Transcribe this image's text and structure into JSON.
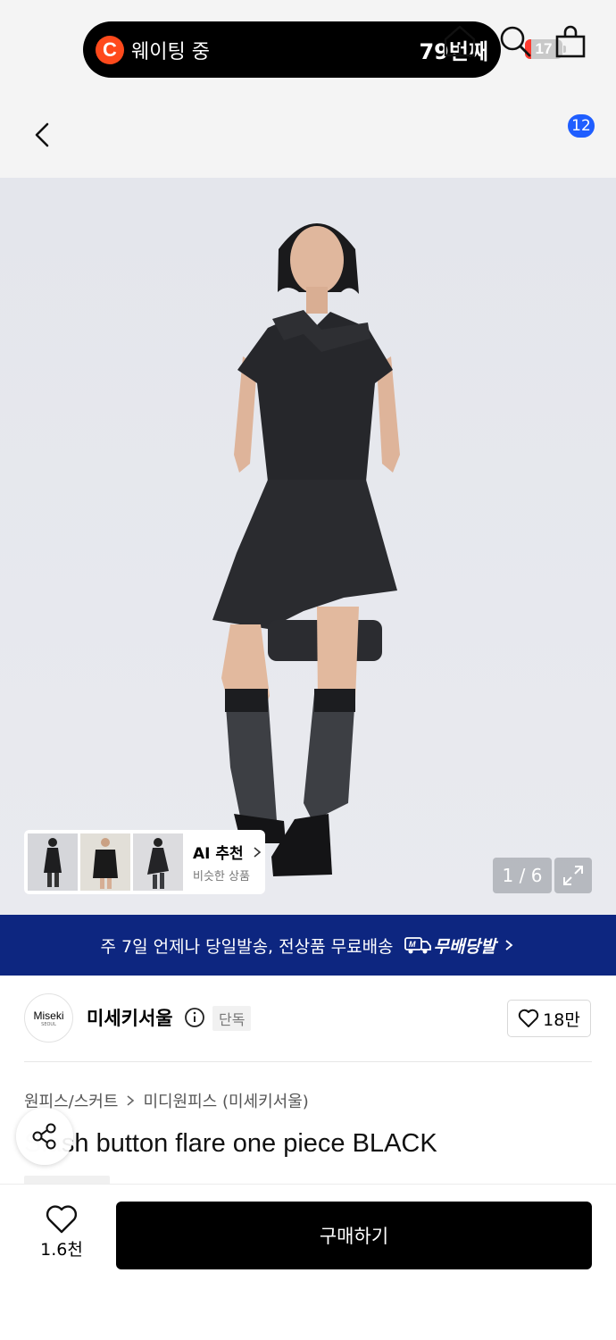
{
  "status_bar": {
    "waiting_logo": "C",
    "waiting_text": "웨이팅 중",
    "waiting_count": "79번째",
    "battery_level": "17",
    "battery_fraction": 0.17
  },
  "nav": {
    "back_icon": "chevron-left-icon",
    "home_icon": "home-icon",
    "search_icon": "search-icon",
    "cart_icon": "shopping-bag-icon",
    "cart_badge": "12"
  },
  "gallery": {
    "ai_title": "AI 추천",
    "ai_subtitle": "비슷한 상품",
    "counter": "1 / 6",
    "expand_icon": "expand-icon"
  },
  "promo": {
    "text": "주 7일 언제나 당일발송, 전상품 무료배송",
    "badge_label": "무배당발",
    "badge_mark": "M"
  },
  "brand": {
    "logo_text": "Miseki",
    "logo_sub": "SEOUL",
    "name": "미세키서울",
    "tag": "단독",
    "likes": "18만"
  },
  "product": {
    "breadcrumb": [
      "원피스/스커트",
      "미디원피스 (미세키서울)"
    ],
    "title": "Slash button flare one piece BLACK",
    "title_visible": "sh button flare one piece BLACK"
  },
  "bottom": {
    "wish_count": "1.6천",
    "buy_label": "구매하기"
  },
  "colors": {
    "accent_blue": "#1f5eff",
    "promo_navy": "#0d2680",
    "logo_orange": "#ff4a1c"
  }
}
